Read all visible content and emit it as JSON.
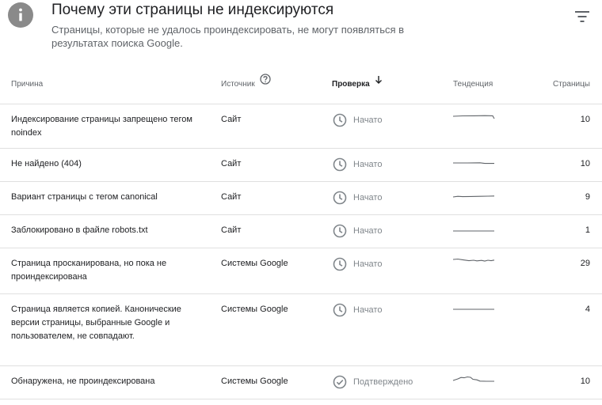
{
  "header": {
    "title": "Почему эти страницы не индексируются",
    "subtitle": "Страницы, которые не удалось проиндексировать, не могут появляться в результатах поиска Google.",
    "info_icon": "info-icon",
    "filter_icon": "filter-icon"
  },
  "table": {
    "columns": {
      "reason": "Причина",
      "source": "Источник",
      "check": "Проверка",
      "trend": "Тенденция",
      "pages": "Страницы"
    },
    "rows": [
      {
        "reason": "Индексирование страницы запрещено тегом noindex",
        "source": "Сайт",
        "status": "Начато",
        "status_icon": "clock-icon",
        "pages": "10"
      },
      {
        "reason": "Не найдено (404)",
        "source": "Сайт",
        "status": "Начато",
        "status_icon": "clock-icon",
        "pages": "10"
      },
      {
        "reason": "Вариант страницы с тегом canonical",
        "source": "Сайт",
        "status": "Начато",
        "status_icon": "clock-icon",
        "pages": "9"
      },
      {
        "reason": "Заблокировано в файле robots.txt",
        "source": "Сайт",
        "status": "Начато",
        "status_icon": "clock-icon",
        "pages": "1"
      },
      {
        "reason": "Страница просканирована, но пока не проиндексирована",
        "source": "Системы Google",
        "status": "Начато",
        "status_icon": "clock-icon",
        "pages": "29"
      },
      {
        "reason": "Страница является копией. Канонические версии страницы, выбранные Google и пользователем, не совпадают.",
        "source": "Системы Google",
        "status": "Начато",
        "status_icon": "clock-icon",
        "pages": "4"
      },
      {
        "reason": "Обнаружена, не проиндексирована",
        "source": "Системы Google",
        "status": "Подтверждено",
        "status_icon": "check-circle-icon",
        "pages": "10"
      }
    ]
  },
  "colors": {
    "text": "#202124",
    "muted": "#5f6368",
    "status": "#80868b",
    "divider": "#e0e0e0"
  }
}
